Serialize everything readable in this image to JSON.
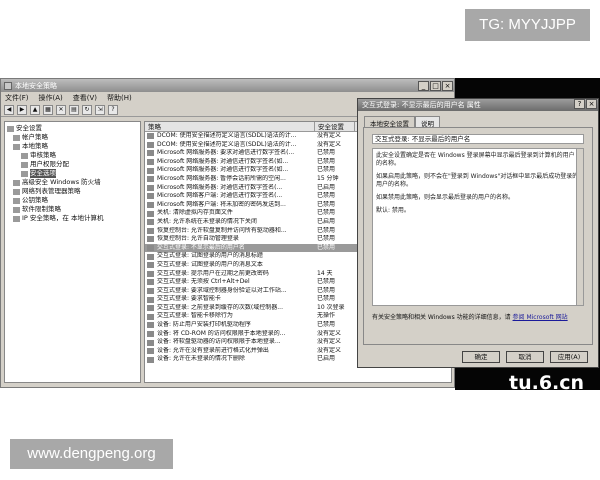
{
  "watermark_top": "TG: MYYJJPP",
  "watermark_bottom": "www.dengpeng.org",
  "watermark_right": "tu.6.cn",
  "window": {
    "title": "本地安全策略",
    "controls": [
      "_",
      "□",
      "×"
    ],
    "menu": [
      "文件(F)",
      "操作(A)",
      "查看(V)",
      "帮助(H)"
    ],
    "toolbar_icons": [
      "back-icon",
      "forward-icon",
      "up-icon",
      "show-hide-icon",
      "delete-icon",
      "properties-icon",
      "refresh-icon",
      "export-icon",
      "help-icon"
    ]
  },
  "tree": [
    "安全设置",
    "帐户策略",
    "本地策略",
    "审核策略",
    "用户权限分配",
    "安全选项",
    "高级安全 Windows 防火墙",
    "网络列表管理器策略",
    "公钥策略",
    "软件限制策略",
    "IP 安全策略，在 本地计算机"
  ],
  "list": {
    "headers": [
      "策略",
      "安全设置"
    ],
    "rows": [
      [
        "DCOM: 使用安全描述符定义语言(SDDL)语法的计...",
        "没有定义"
      ],
      [
        "DCOM: 使用安全描述符定义语言(SDDL)语法的计...",
        "没有定义"
      ],
      [
        "Microsoft 网络服务器: 要求对通信进行数字签名(...",
        "已禁用"
      ],
      [
        "Microsoft 网络服务器: 对通信进行数字签名(如...",
        "已禁用"
      ],
      [
        "Microsoft 网络服务器: 对通信进行数字签名(如...",
        "已禁用"
      ],
      [
        "Microsoft 网络服务器: 暂停会话前所需的空闲...",
        "15 分钟"
      ],
      [
        "Microsoft 网络服务器: 对通信进行数字签名(...",
        "已启用"
      ],
      [
        "Microsoft 网络客户端: 对通信进行数字签名(...",
        "已禁用"
      ],
      [
        "Microsoft 网络客户端: 将未加密的密码发送到...",
        "已禁用"
      ],
      [
        "关机: 清除虚拟内存页面文件",
        "已禁用"
      ],
      [
        "关机: 允许系统在未登录的情况下关闭",
        "已启用"
      ],
      [
        "恢复控制台: 允许软盘复制并访问所有驱动器和...",
        "已禁用"
      ],
      [
        "恢复控制台: 允许自动管理登录",
        "已禁用"
      ],
      [
        "交互式登录: 不显示最后的用户名",
        "已禁用"
      ],
      [
        "交互式登录: 试图登录的用户的消息标题",
        ""
      ],
      [
        "交互式登录: 试图登录的用户的消息文本",
        ""
      ],
      [
        "交互式登录: 提示用户在过期之前更改密码",
        "14 天"
      ],
      [
        "交互式登录: 无须按 Ctrl+Alt+Del",
        "已禁用"
      ],
      [
        "交互式登录: 要求域控制器身份验证以对工作站...",
        "已禁用"
      ],
      [
        "交互式登录: 要求智能卡",
        "已禁用"
      ],
      [
        "交互式登录: 之前登录到缓存的次数(域控制器...",
        "10 次登录"
      ],
      [
        "交互式登录: 智能卡移除行为",
        "无操作"
      ],
      [
        "设备: 防止用户安装打印机驱动程序",
        "已禁用"
      ],
      [
        "设备: 将 CD-ROM 的访问权限限于本地登录的...",
        "没有定义"
      ],
      [
        "设备: 将软盘驱动器的访问权限限于本地登录...",
        "没有定义"
      ],
      [
        "设备: 允许在没有登录前进行格式化并弹出",
        "没有定义"
      ],
      [
        "设备: 允许在未登录的情况下删除",
        "已启用"
      ]
    ],
    "highlighted_index": 13
  },
  "dialog": {
    "title": "交互式登录: 不显示最后的用户名 属性",
    "controls": [
      "?",
      "×"
    ],
    "tabs": [
      "本地安全设置",
      "说明"
    ],
    "active_tab": 1,
    "policy_name": "交互式登录: 不显示最后的用户名",
    "explanation": [
      "此安全设置确定是否在 Windows 登录屏幕中显示最后登录到计算机的用户的名称。",
      "如果启用此策略，则不会在\"登录到 Windows\"对话框中显示最后成功登录的用户的名称。",
      "如果禁用此策略，则会显示最后登录的用户的名称。",
      "默认: 禁用。"
    ],
    "more_info_text": "有关安全策略和相关 Windows 功能的详细信息，请",
    "more_info_link": "参阅 Microsoft 网站",
    "buttons": [
      "确定",
      "取消",
      "应用(A)"
    ]
  }
}
